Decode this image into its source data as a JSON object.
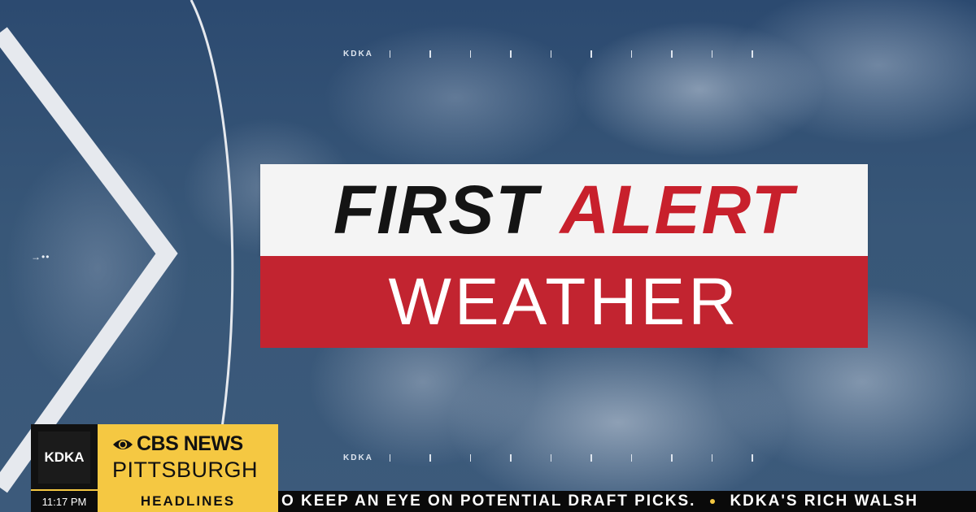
{
  "graphic": {
    "top_ticker_call": "KDKA",
    "bottom_ticker_call": "KDKA",
    "arrow_glyph": "→••"
  },
  "title": {
    "line1_word1": "FIRST",
    "line1_word2": "ALERT",
    "line2": "WEATHER",
    "colors": {
      "red": "#c22430",
      "light": "#f4f4f4",
      "dark": "#141414"
    }
  },
  "station": {
    "call_letters": "KDKA",
    "network": "CBS NEWS",
    "city": "PITTSBURGH",
    "eye_icon": "cbs-eye-icon",
    "brand_yellow": "#f5c842"
  },
  "lower_third": {
    "time": "11:17 PM",
    "section": "HEADLINES",
    "crawl_text_1": "O KEEP AN EYE ON POTENTIAL DRAFT PICKS.",
    "crawl_text_2": "KDKA'S RICH WALSH"
  }
}
